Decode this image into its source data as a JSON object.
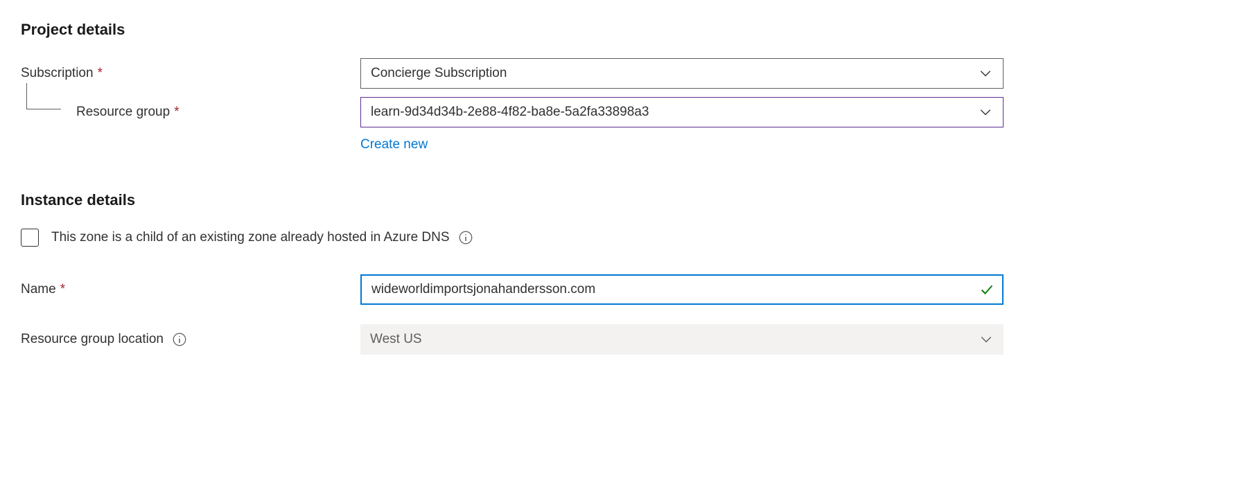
{
  "project_details": {
    "heading": "Project details",
    "subscription": {
      "label": "Subscription",
      "value": "Concierge Subscription"
    },
    "resource_group": {
      "label": "Resource group",
      "value": "learn-9d34d34b-2e88-4f82-ba8e-5a2fa33898a3",
      "create_new": "Create new"
    }
  },
  "instance_details": {
    "heading": "Instance details",
    "child_zone": {
      "label": "This zone is a child of an existing zone already hosted in Azure DNS",
      "checked": false
    },
    "name": {
      "label": "Name",
      "value": "wideworldimportsjonahandersson.com"
    },
    "location": {
      "label": "Resource group location",
      "value": "West US"
    }
  }
}
